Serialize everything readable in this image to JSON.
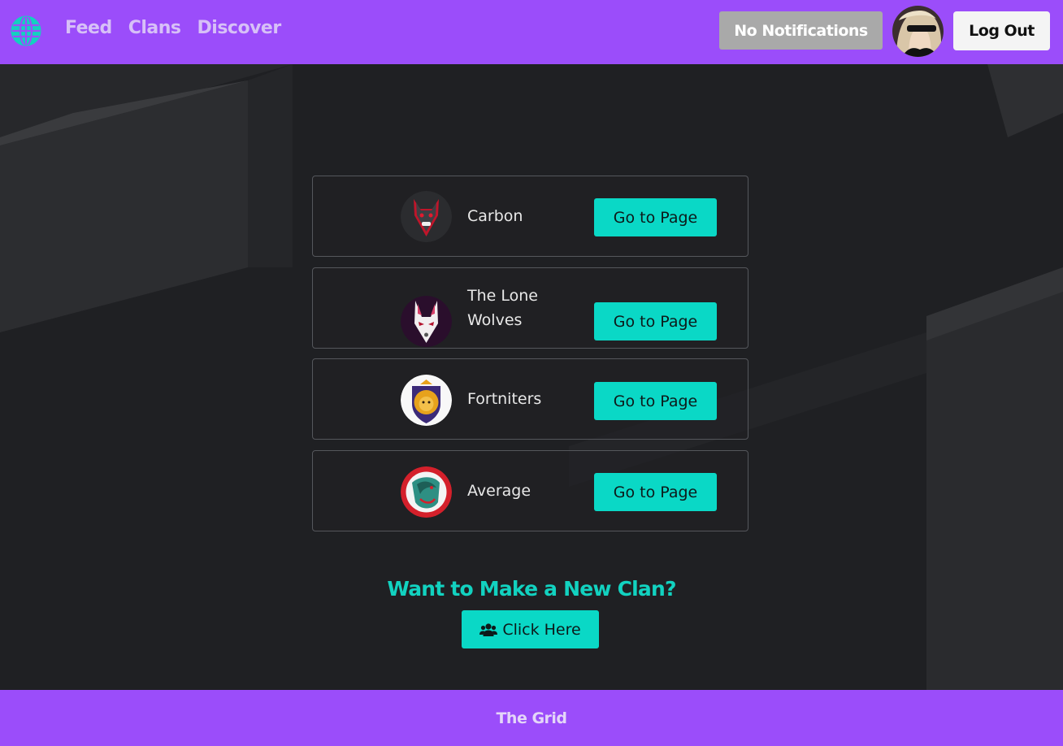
{
  "nav": {
    "links": [
      "Feed",
      "Clans",
      "Discover"
    ],
    "notifications_label": "No Notifications",
    "logout_label": "Log Out"
  },
  "clans": [
    {
      "name": "Carbon",
      "button": "Go to Page",
      "emblem": "wolf-emblem"
    },
    {
      "name": "The Lone Wolves",
      "button": "Go to Page",
      "emblem": "fox-mask-emblem"
    },
    {
      "name": "Fortniters",
      "button": "Go to Page",
      "emblem": "lion-emblem"
    },
    {
      "name": "Average",
      "button": "Go to Page",
      "emblem": "dragon-emblem"
    }
  ],
  "cta": {
    "heading": "Want to Make a New Clan?",
    "button": "Click Here",
    "icon": "users-icon"
  },
  "footer": {
    "text": "The Grid"
  },
  "colors": {
    "brand_purple": "#9b4dfa",
    "accent_teal": "#0ad8c6",
    "background": "#1f2023"
  }
}
